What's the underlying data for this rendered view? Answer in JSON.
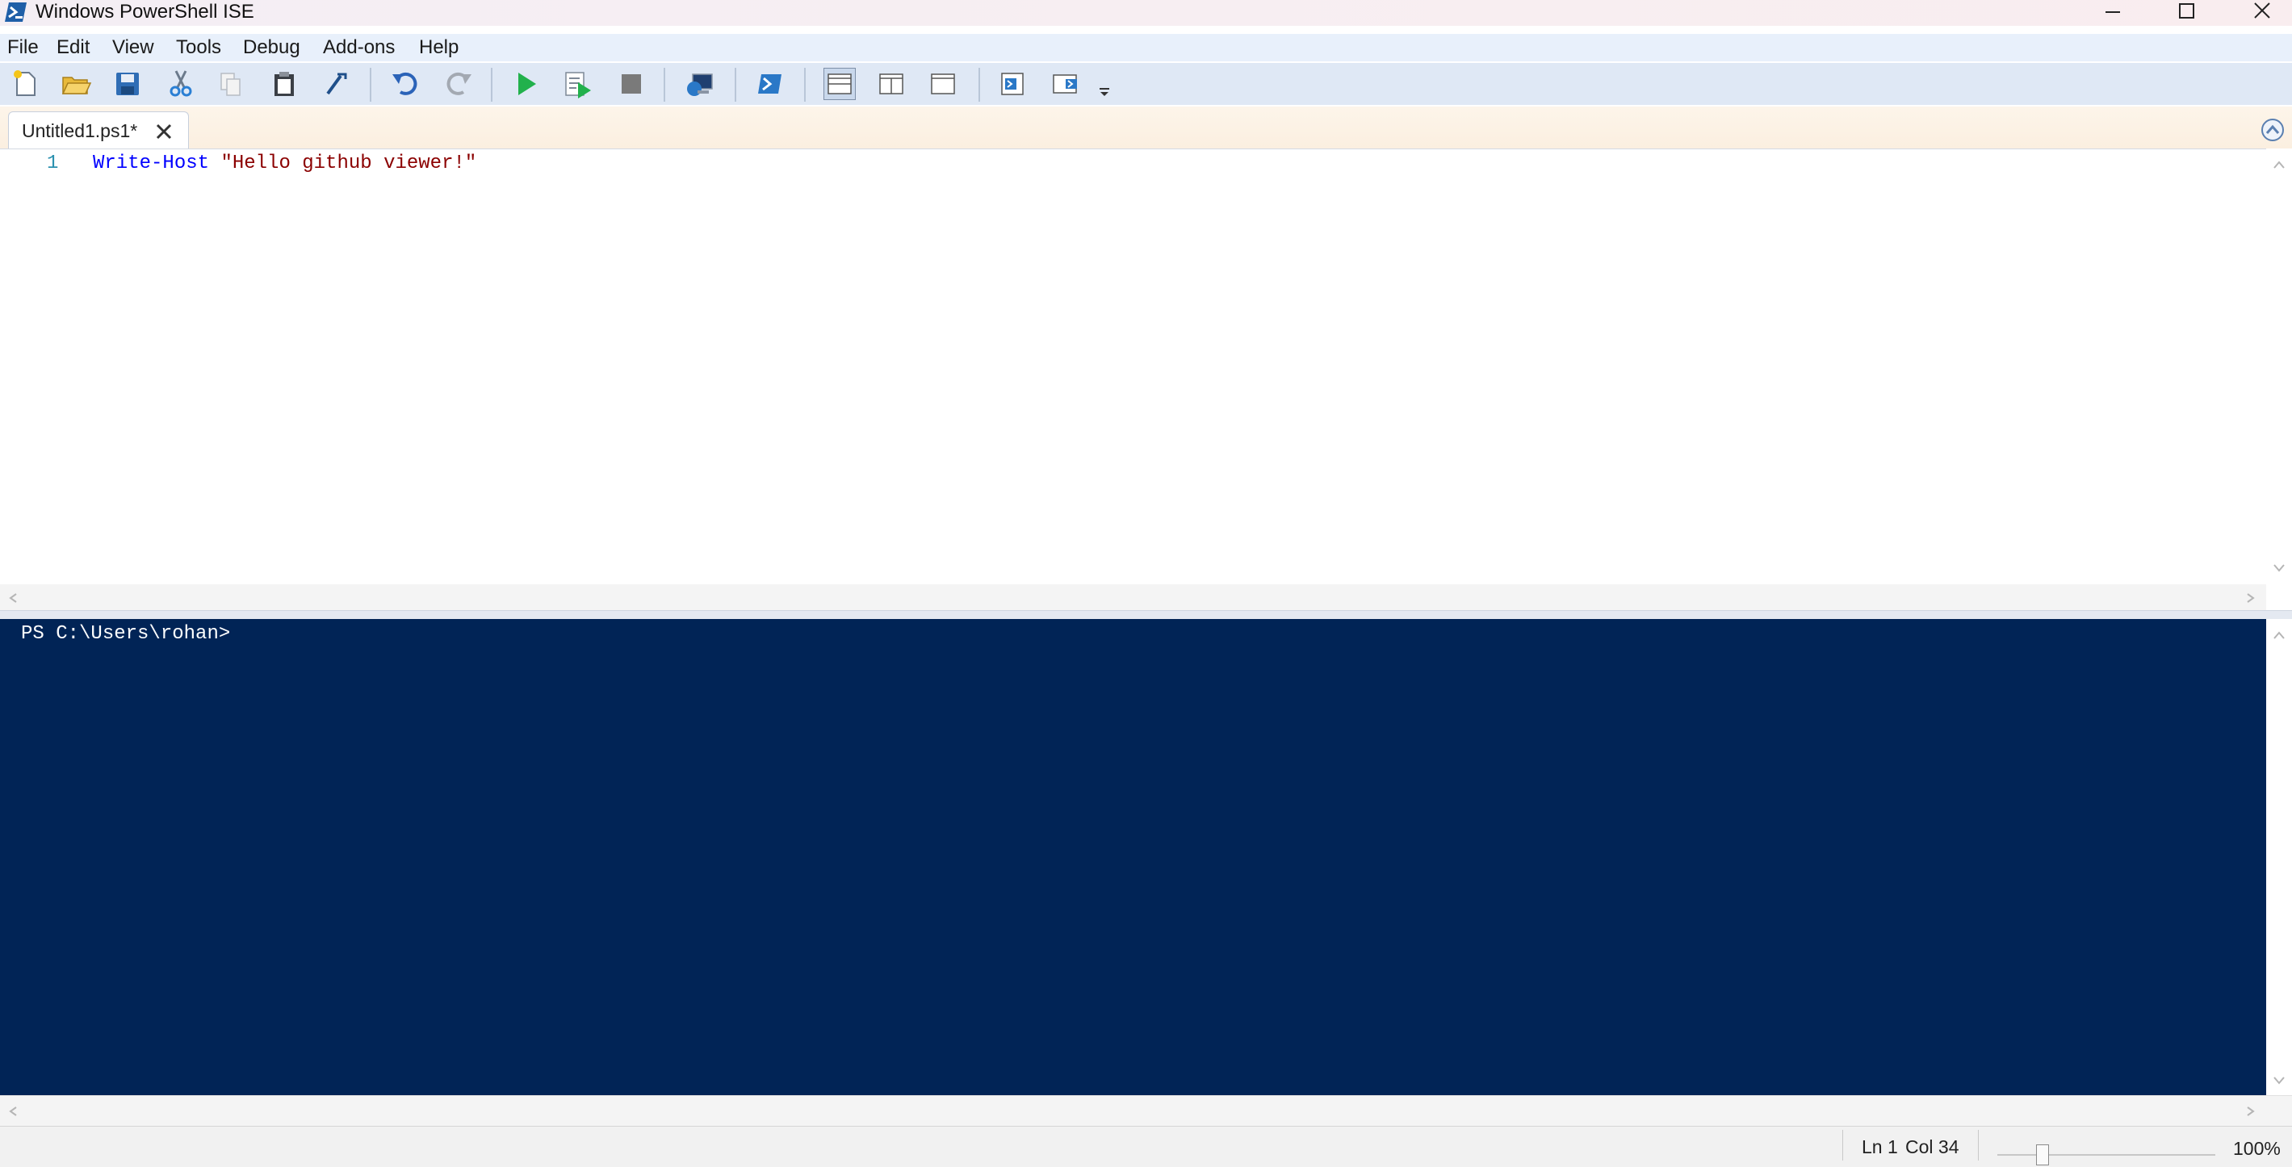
{
  "window": {
    "title": "Windows PowerShell ISE",
    "controls": [
      "minimize",
      "maximize",
      "close"
    ]
  },
  "menu": [
    "File",
    "Edit",
    "View",
    "Tools",
    "Debug",
    "Add-ons",
    "Help"
  ],
  "toolbar": {
    "buttons": [
      "new-file",
      "open",
      "save",
      "cut",
      "copy",
      "paste",
      "clear-console",
      "undo",
      "redo",
      "run-script",
      "run-selection",
      "stop",
      "new-remote-tab",
      "start-powershell",
      "show-script-top",
      "show-script-right",
      "show-script-max",
      "show-command",
      "show-command-addon",
      "customize"
    ]
  },
  "tabs": [
    {
      "label": "Untitled1.ps1*",
      "active": true
    }
  ],
  "editor": {
    "lines": [
      {
        "number": "1",
        "cmdlet": "Write-Host",
        "string": "\"Hello github viewer!\""
      }
    ]
  },
  "console": {
    "prompt": "PS C:\\Users\\rohan>"
  },
  "status": {
    "line": "Ln 1",
    "col": "Col 34",
    "zoom": "100%",
    "zoom_level": 1.0
  },
  "colors": {
    "console_bg": "#012456",
    "cmdlet": "#0000ff",
    "string": "#8b0000"
  }
}
